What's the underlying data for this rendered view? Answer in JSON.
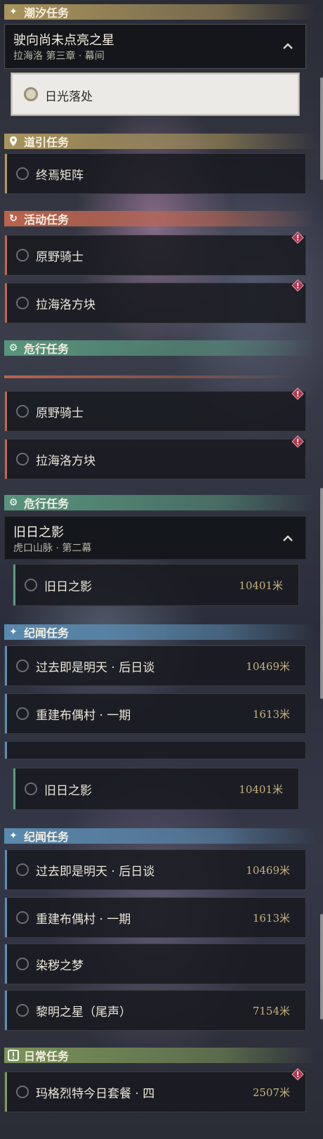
{
  "panel1": {
    "tide": {
      "header": "潮汐任务",
      "group_title": "驶向尚未点亮之星",
      "group_subtitle": "拉海洛 第三章 · 幕间",
      "selected_task": "日光落处"
    },
    "guide": {
      "header": "道引任务",
      "task": "终焉矩阵"
    },
    "event": {
      "header": "活动任务",
      "tasks": [
        "原野骑士",
        "拉海洛方块"
      ]
    },
    "danger": {
      "header": "危行任务"
    }
  },
  "panel2": {
    "event": {
      "tasks": [
        "原野骑士",
        "拉海洛方块"
      ]
    },
    "danger": {
      "header": "危行任务",
      "group_title": "旧日之影",
      "group_subtitle": "虎口山脉 · 第二幕",
      "task": {
        "label": "旧日之影",
        "distance": "10401米"
      }
    },
    "lore": {
      "header": "纪闻任务",
      "tasks": [
        {
          "label": "过去即是明天 · 后日谈",
          "distance": "10469米"
        },
        {
          "label": "重建布偶村 · 一期",
          "distance": "1613米"
        }
      ]
    }
  },
  "panel3": {
    "danger_task": {
      "label": "旧日之影",
      "distance": "10401米"
    },
    "lore": {
      "header": "纪闻任务",
      "tasks": [
        {
          "label": "过去即是明天 · 后日谈",
          "distance": "10469米"
        },
        {
          "label": "重建布偶村 · 一期",
          "distance": "1613米"
        },
        {
          "label": "染秽之梦",
          "distance": ""
        },
        {
          "label": "黎明之星（尾声）",
          "distance": "7154米"
        }
      ]
    },
    "daily": {
      "header": "日常任务",
      "task": {
        "label": "玛格烈特今日套餐 · 四",
        "distance": "2507米"
      }
    }
  },
  "colors": {
    "tide": "#b09a5e",
    "guide": "#b09a5e",
    "event": "#c2664f",
    "danger": "#5a9a80",
    "lore": "#5b8fb5",
    "daily": "#7f9a5a",
    "distance": "#c6b27f"
  },
  "icons": {
    "tide": "sparkle-icon",
    "guide": "map-pin-icon",
    "event": "refresh-flag-icon",
    "danger": "gear-eye-icon",
    "lore": "sparkle-icon",
    "daily": "exclamation-box-icon",
    "alert": "diamond-alert-icon",
    "collapse": "chevron-up-icon"
  }
}
